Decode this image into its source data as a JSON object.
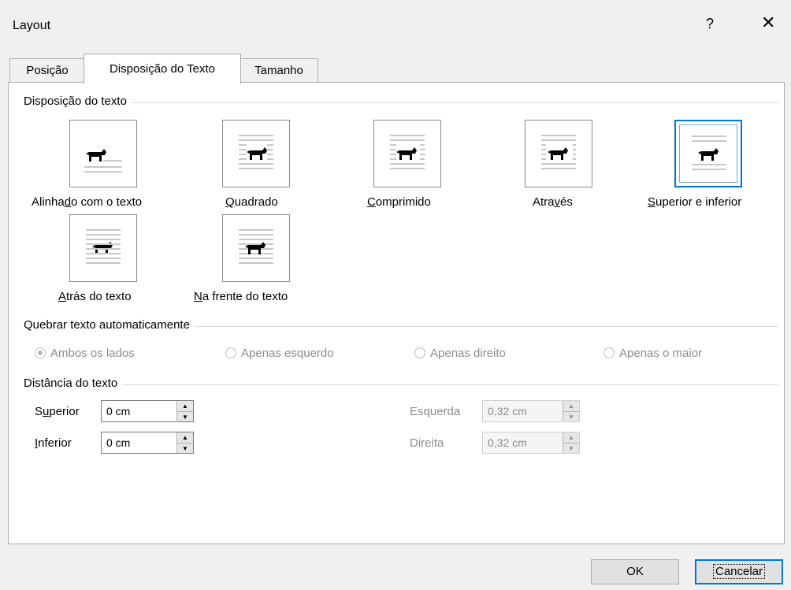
{
  "window": {
    "title": "Layout",
    "help_label": "?",
    "close_label": "✕"
  },
  "tabs": [
    {
      "label": "Posição",
      "active": false
    },
    {
      "label": "Disposição do Texto",
      "active": true
    },
    {
      "label": "Tamanho",
      "active": false
    }
  ],
  "wrap_section": {
    "title": "Disposição do texto",
    "options": [
      {
        "label_pre": "Alinha",
        "label_u": "d",
        "label_post": "o com o texto",
        "selected": false
      },
      {
        "label_pre": "",
        "label_u": "Q",
        "label_post": "uadrado",
        "selected": false
      },
      {
        "label_pre": "",
        "label_u": "C",
        "label_post": "omprimido",
        "selected": false
      },
      {
        "label_pre": "Atra",
        "label_u": "v",
        "label_post": "és",
        "selected": false
      },
      {
        "label_pre": "",
        "label_u": "S",
        "label_post": "uperior e inferior",
        "selected": true
      },
      {
        "label_pre": "",
        "label_u": "A",
        "label_post": "trás do texto",
        "selected": false
      },
      {
        "label_pre": "",
        "label_u": "N",
        "label_post": "a frente do texto",
        "selected": false
      }
    ]
  },
  "auto_wrap": {
    "title": "Quebrar texto automaticamente",
    "options": [
      "Ambos os lados",
      "Apenas esquerdo",
      "Apenas direito",
      "Apenas o maior"
    ],
    "selected": "Ambos os lados",
    "disabled": true
  },
  "distance": {
    "title": "Distância do texto",
    "superior": {
      "label_pre": "S",
      "label_u": "u",
      "label_post": "perior",
      "value": "0 cm"
    },
    "inferior": {
      "label_pre": "",
      "label_u": "I",
      "label_post": "nferior",
      "value": "0 cm"
    },
    "esquerda": {
      "label": "Esquerda",
      "value": "0,32 cm",
      "disabled": true
    },
    "direita": {
      "label": "Direita",
      "value": "0,32 cm",
      "disabled": true
    }
  },
  "buttons": {
    "ok": "OK",
    "cancel": "Cancelar"
  },
  "colors": {
    "accent": "#0078d7",
    "background": "#f0f0f0",
    "panel": "#ffffff",
    "disabled_text": "#8c8c8c"
  },
  "icons": {
    "wrap_thumbnail": "dog-silhouette-icon"
  }
}
